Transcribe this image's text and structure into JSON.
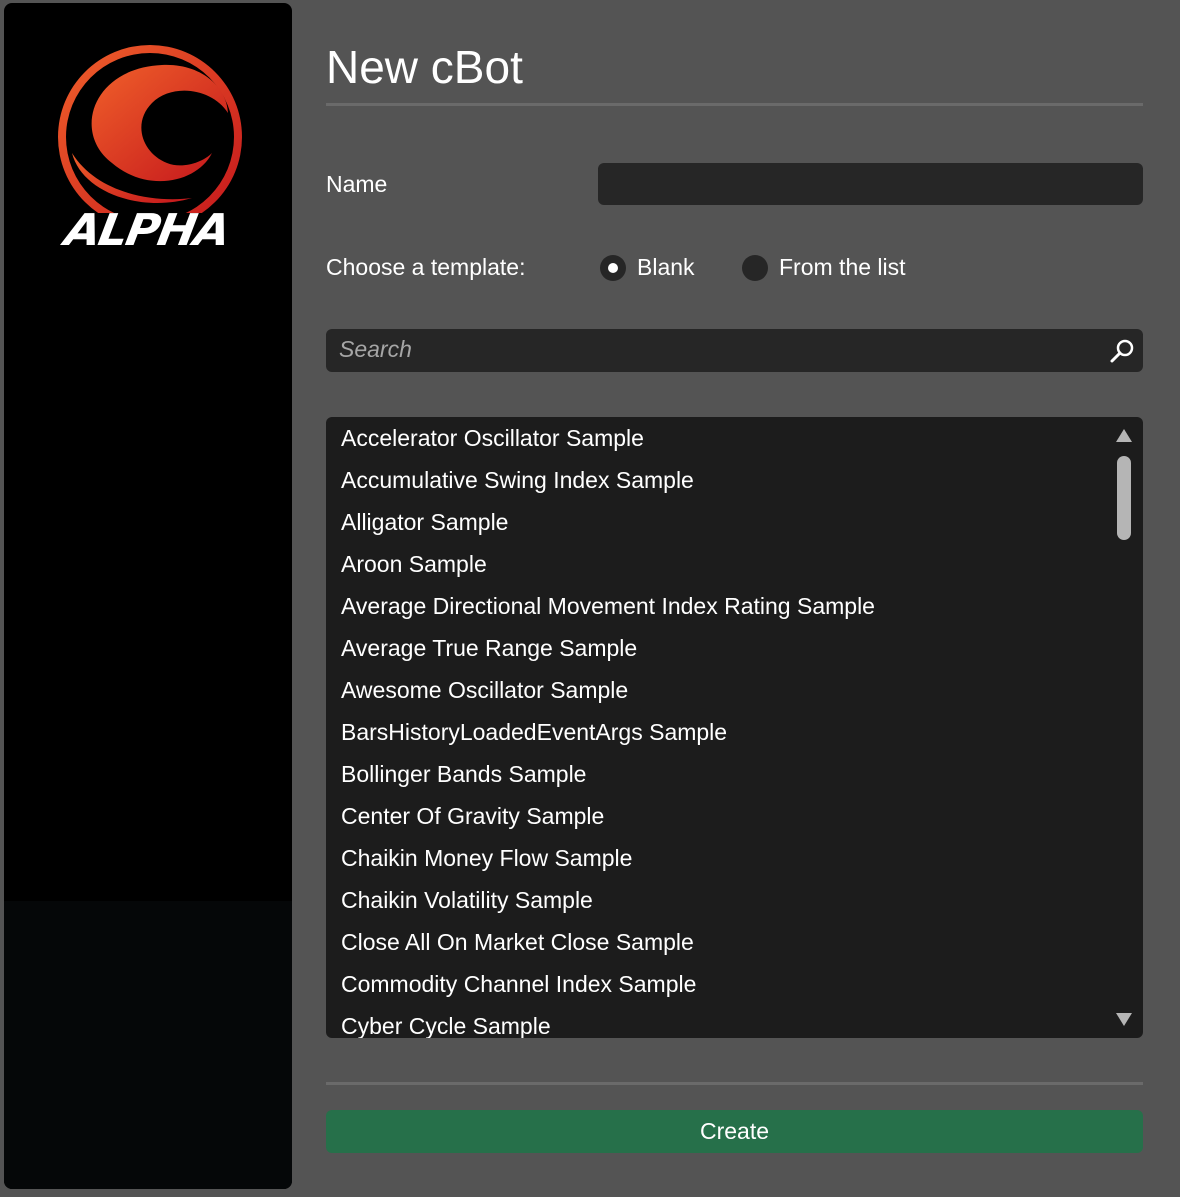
{
  "sidebar": {
    "logo_text": "ALPHA",
    "colors": {
      "logo_red": "#e2332a",
      "logo_orange": "#f0522a"
    }
  },
  "dialog": {
    "title": "New cBot",
    "name_label": "Name",
    "name_value": "",
    "template_label": "Choose a template:",
    "template_options": [
      {
        "label": "Blank",
        "selected": true
      },
      {
        "label": "From the list",
        "selected": false
      }
    ],
    "search_placeholder": "Search",
    "list_items": [
      "Accelerator Oscillator Sample",
      "Accumulative Swing Index Sample",
      "Alligator Sample",
      "Aroon Sample",
      "Average Directional Movement Index Rating Sample",
      "Average True Range Sample",
      "Awesome Oscillator Sample",
      "BarsHistoryLoadedEventArgs Sample",
      "Bollinger Bands Sample",
      "Center Of Gravity Sample",
      "Chaikin Money Flow Sample",
      "Chaikin Volatility Sample",
      "Close All On Market Close Sample",
      "Commodity Channel Index Sample",
      "Cyber Cycle Sample"
    ],
    "create_label": "Create",
    "colors": {
      "background": "#545454",
      "input_bg": "#262626",
      "list_bg": "#1c1c1c",
      "create_button": "#26704a"
    }
  }
}
